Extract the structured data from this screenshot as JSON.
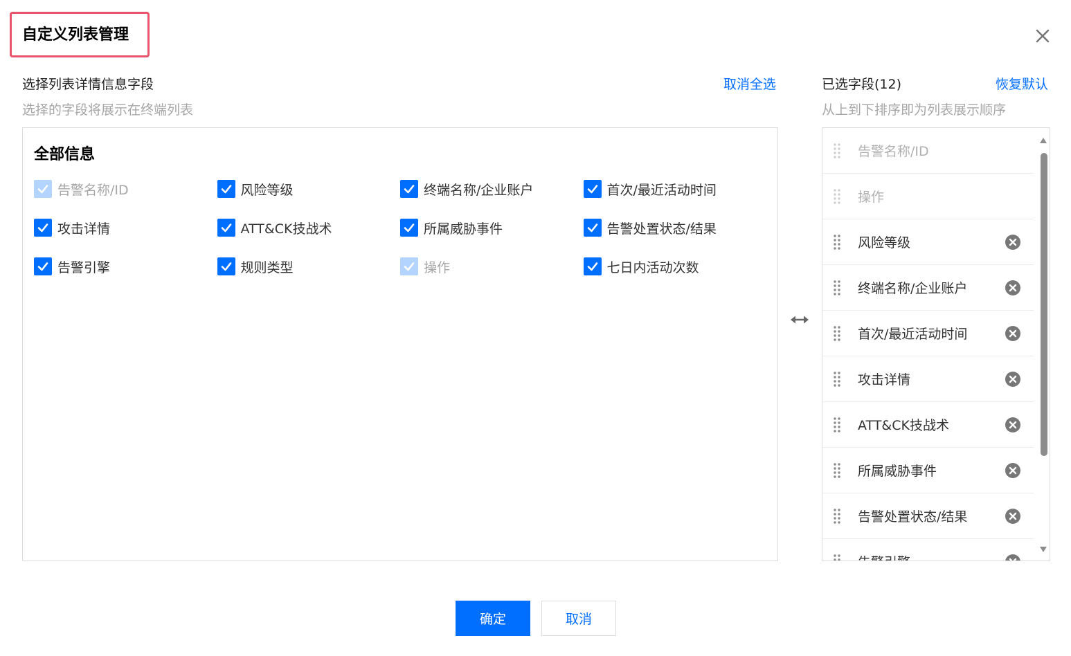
{
  "dialog": {
    "title": "自定义列表管理"
  },
  "left": {
    "label": "选择列表详情信息字段",
    "sublabel": "选择的字段将展示在终端列表",
    "cancel_all": "取消全选",
    "group_title": "全部信息",
    "options": [
      {
        "label": "告警名称/ID",
        "checked": true,
        "disabled": true
      },
      {
        "label": "风险等级",
        "checked": true,
        "disabled": false
      },
      {
        "label": "终端名称/企业账户",
        "checked": true,
        "disabled": false
      },
      {
        "label": "首次/最近活动时间",
        "checked": true,
        "disabled": false
      },
      {
        "label": "攻击详情",
        "checked": true,
        "disabled": false
      },
      {
        "label": "ATT&CK技战术",
        "checked": true,
        "disabled": false
      },
      {
        "label": "所属威胁事件",
        "checked": true,
        "disabled": false
      },
      {
        "label": "告警处置状态/结果",
        "checked": true,
        "disabled": false
      },
      {
        "label": "告警引擎",
        "checked": true,
        "disabled": false
      },
      {
        "label": "规则类型",
        "checked": true,
        "disabled": false
      },
      {
        "label": "操作",
        "checked": true,
        "disabled": true
      },
      {
        "label": "七日内活动次数",
        "checked": true,
        "disabled": false
      }
    ]
  },
  "right": {
    "label": "已选字段(12)",
    "restore_default": "恢复默认",
    "sublabel": "从上到下排序即为列表展示顺序",
    "items": [
      {
        "label": "告警名称/ID",
        "removable": false
      },
      {
        "label": "操作",
        "removable": false
      },
      {
        "label": "风险等级",
        "removable": true
      },
      {
        "label": "终端名称/企业账户",
        "removable": true
      },
      {
        "label": "首次/最近活动时间",
        "removable": true
      },
      {
        "label": "攻击详情",
        "removable": true
      },
      {
        "label": "ATT&CK技战术",
        "removable": true
      },
      {
        "label": "所属威胁事件",
        "removable": true
      },
      {
        "label": "告警处置状态/结果",
        "removable": true
      },
      {
        "label": "告警引擎",
        "removable": true
      }
    ]
  },
  "footer": {
    "ok": "确定",
    "cancel": "取消"
  },
  "colors": {
    "primary": "#006eff",
    "checkbox_disabled": "#b3d4ff",
    "title_highlight": "#e8546b"
  }
}
